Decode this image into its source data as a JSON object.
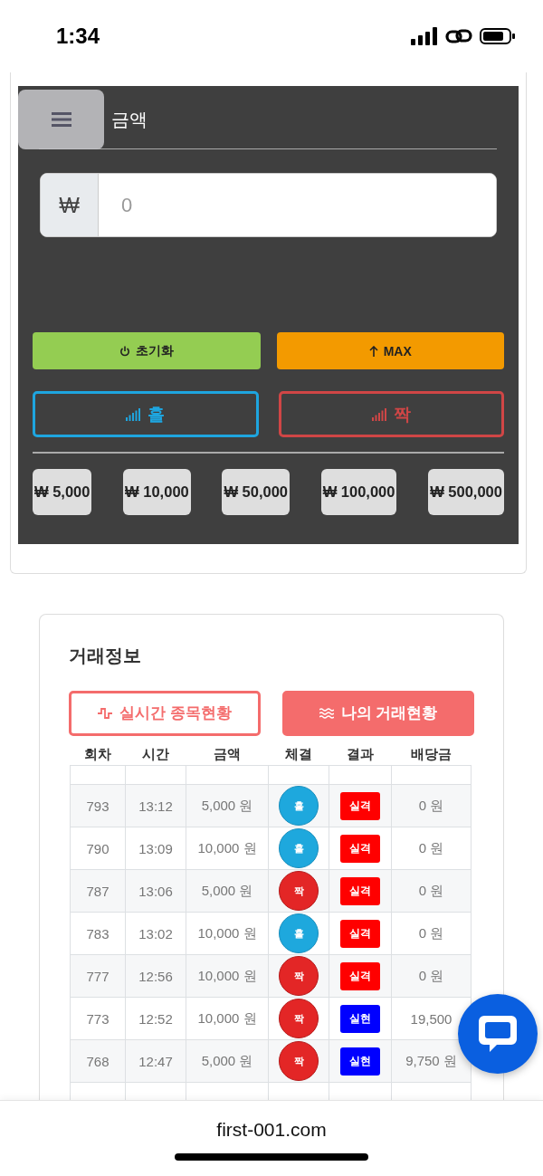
{
  "status_bar": {
    "time": "1:34"
  },
  "bet_panel": {
    "title": "금액",
    "currency": "₩",
    "amount_placeholder": "0",
    "reset_button": "초기화",
    "max_button": "MAX",
    "choices": [
      {
        "label": "홀",
        "kind": "odd"
      },
      {
        "label": "짝",
        "kind": "even"
      }
    ],
    "chips": [
      "₩ 5,000",
      "₩ 10,000",
      "₩ 50,000",
      "₩ 100,000",
      "₩ 500,000"
    ]
  },
  "trade_info": {
    "title": "거래정보",
    "tabs": [
      {
        "label": "실시간 종목현황",
        "selected": false,
        "kind": "pulse"
      },
      {
        "label": "나의 거래현황",
        "selected": true,
        "kind": "waves"
      }
    ],
    "columns": [
      "회차",
      "시간",
      "금액",
      "체결",
      "결과",
      "배당금"
    ],
    "rows": [
      {
        "round": "793",
        "time": "13:12",
        "amount": "5,000 원",
        "pick": {
          "label": "홀",
          "kind": "odd"
        },
        "result": {
          "label": "실격",
          "kind": "lose"
        },
        "payout": "0 원"
      },
      {
        "round": "790",
        "time": "13:09",
        "amount": "10,000 원",
        "pick": {
          "label": "홀",
          "kind": "odd"
        },
        "result": {
          "label": "실격",
          "kind": "lose"
        },
        "payout": "0 원"
      },
      {
        "round": "787",
        "time": "13:06",
        "amount": "5,000 원",
        "pick": {
          "label": "짝",
          "kind": "even"
        },
        "result": {
          "label": "실격",
          "kind": "lose"
        },
        "payout": "0 원"
      },
      {
        "round": "783",
        "time": "13:02",
        "amount": "10,000 원",
        "pick": {
          "label": "홀",
          "kind": "odd"
        },
        "result": {
          "label": "실격",
          "kind": "lose"
        },
        "payout": "0 원"
      },
      {
        "round": "777",
        "time": "12:56",
        "amount": "10,000 원",
        "pick": {
          "label": "짝",
          "kind": "even"
        },
        "result": {
          "label": "실격",
          "kind": "lose"
        },
        "payout": "0 원"
      },
      {
        "round": "773",
        "time": "12:52",
        "amount": "10,000 원",
        "pick": {
          "label": "짝",
          "kind": "even"
        },
        "result": {
          "label": "실현",
          "kind": "win"
        },
        "payout": "19,500"
      },
      {
        "round": "768",
        "time": "12:47",
        "amount": "5,000 원",
        "pick": {
          "label": "짝",
          "kind": "even"
        },
        "result": {
          "label": "실현",
          "kind": "win"
        },
        "payout": "9,750 원"
      }
    ]
  },
  "browser": {
    "url": "first-001.com"
  }
}
